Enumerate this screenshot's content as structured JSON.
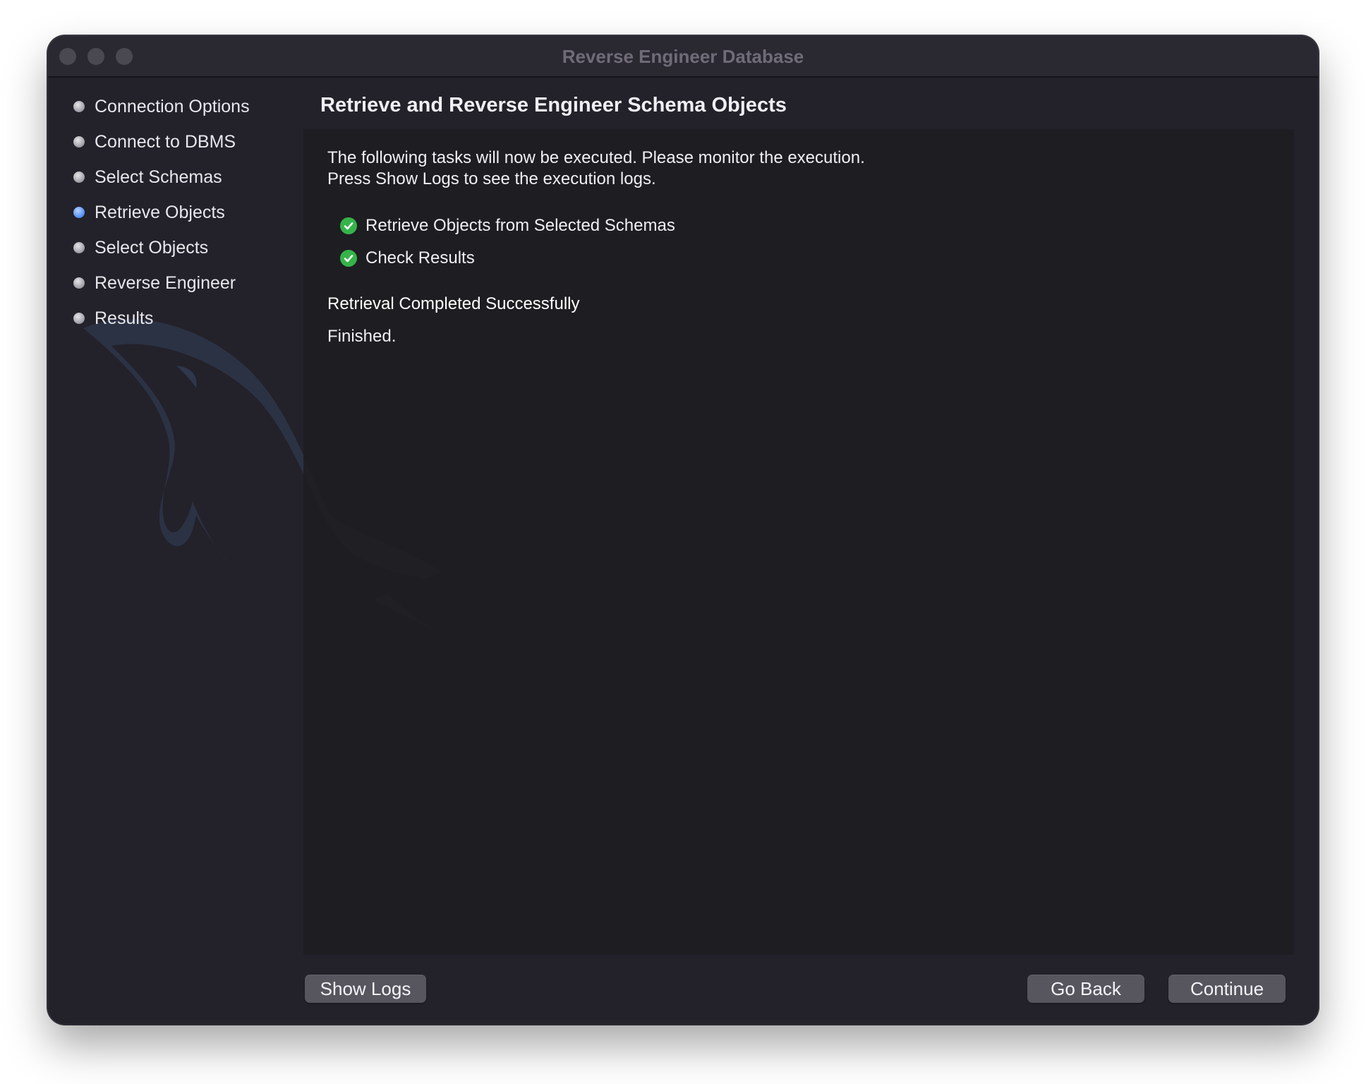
{
  "window": {
    "title": "Reverse Engineer Database"
  },
  "sidebar": {
    "steps": [
      {
        "label": "Connection Options",
        "state": "done"
      },
      {
        "label": "Connect to DBMS",
        "state": "done"
      },
      {
        "label": "Select Schemas",
        "state": "done"
      },
      {
        "label": "Retrieve Objects",
        "state": "current"
      },
      {
        "label": "Select Objects",
        "state": "pending"
      },
      {
        "label": "Reverse Engineer",
        "state": "pending"
      },
      {
        "label": "Results",
        "state": "pending"
      }
    ]
  },
  "main": {
    "heading": "Retrieve and Reverse Engineer Schema Objects",
    "description_line1": "The following tasks will now be executed. Please monitor the execution.",
    "description_line2": "Press Show Logs to see the execution logs.",
    "tasks": [
      {
        "label": "Retrieve Objects from Selected Schemas",
        "icon": "check-circle-icon",
        "status": "done"
      },
      {
        "label": "Check Results",
        "icon": "check-circle-icon",
        "status": "done"
      }
    ],
    "status_title": "Retrieval Completed Successfully",
    "status_text": "Finished."
  },
  "footer": {
    "show_logs_label": "Show Logs",
    "go_back_label": "Go Back",
    "continue_label": "Continue"
  },
  "colors": {
    "accent_blue": "#4c8df6",
    "success_green": "#35b34a"
  }
}
